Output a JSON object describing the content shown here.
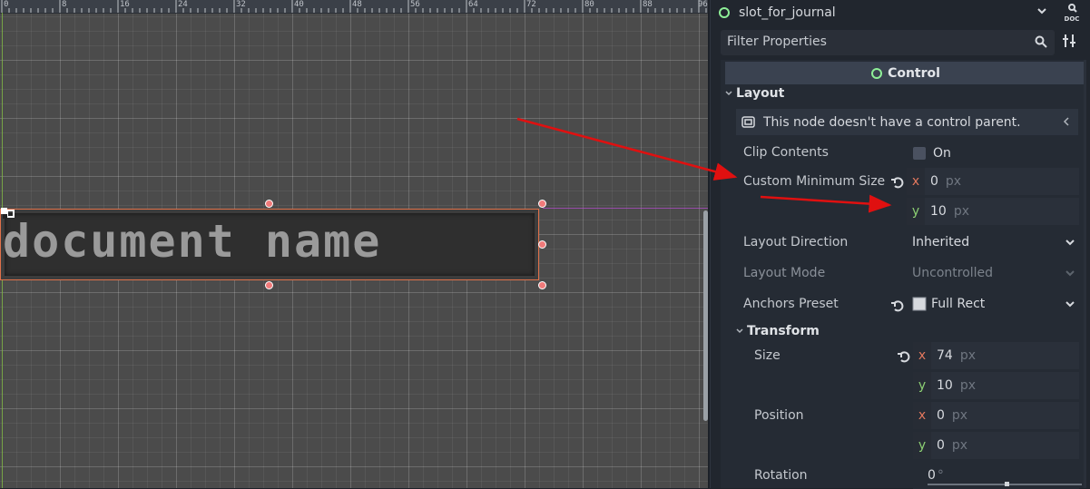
{
  "viewport": {
    "ruler_labels": [
      "0",
      "8",
      "16",
      "24",
      "32",
      "40",
      "48",
      "56",
      "64",
      "72",
      "80",
      "88",
      "96"
    ],
    "node_text": "document name",
    "colors": {
      "selection_border": "#e0714a",
      "handle": "#f07a7a",
      "guide": "#b84bd0",
      "y_axis": "#7ab33d"
    }
  },
  "inspector": {
    "node_name": "slot_for_journal",
    "doc_label": "DOC",
    "filter_placeholder": "Filter Properties",
    "class_section": "Control",
    "layout_group": "Layout",
    "layout_warning": "This node doesn't have a control parent.",
    "properties": {
      "clip_contents": {
        "label": "Clip Contents",
        "value": "On",
        "checked": false
      },
      "custom_minimum_size": {
        "label": "Custom Minimum Size",
        "x": "0",
        "y": "10",
        "unit": "px",
        "axis_x": "x",
        "axis_y": "y"
      },
      "layout_direction": {
        "label": "Layout Direction",
        "value": "Inherited"
      },
      "layout_mode": {
        "label": "Layout Mode",
        "value": "Uncontrolled"
      },
      "anchors_preset": {
        "label": "Anchors Preset",
        "value": "Full Rect"
      }
    },
    "transform_group": "Transform",
    "transform": {
      "size": {
        "label": "Size",
        "x": "74",
        "y": "10",
        "unit": "px",
        "axis_x": "x",
        "axis_y": "y"
      },
      "position": {
        "label": "Position",
        "x": "0",
        "y": "0",
        "unit": "px",
        "axis_x": "x",
        "axis_y": "y"
      },
      "rotation": {
        "label": "Rotation",
        "value": "0",
        "unit": "°"
      }
    },
    "colors": {
      "control_icon": "#8eef97",
      "axis_x": "#e3785e",
      "axis_y": "#8ccf73",
      "annotation_arrow": "#e01010"
    }
  }
}
